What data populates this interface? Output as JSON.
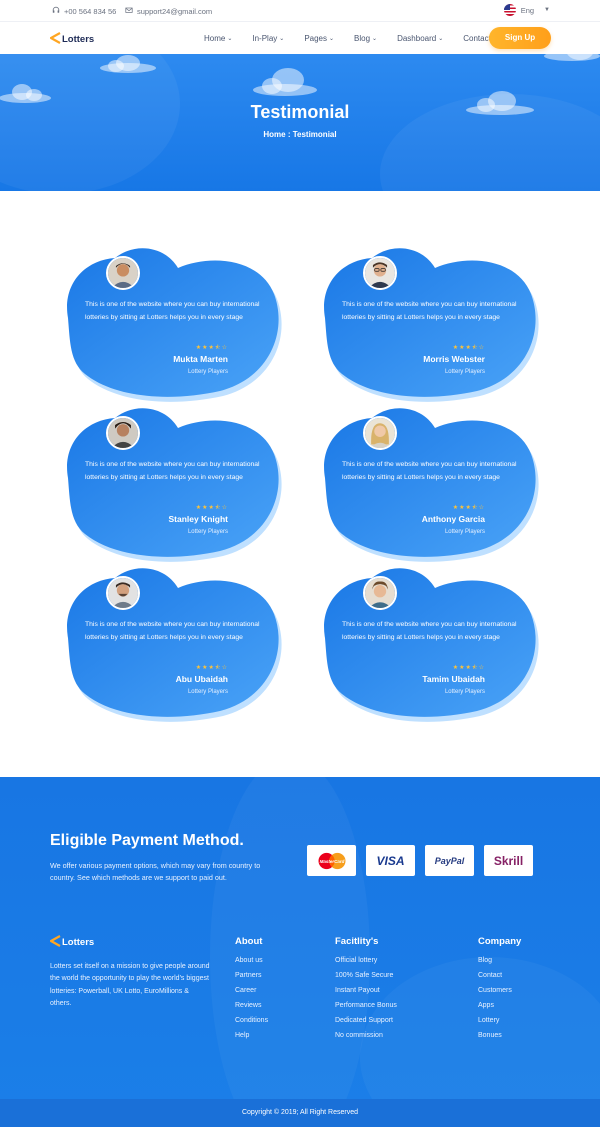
{
  "topbar": {
    "phone": "+00 564 834 56",
    "email": "support24@gmail.com",
    "language": "Eng"
  },
  "nav": {
    "logo_text": "Lotters",
    "menu": [
      {
        "label": "Home",
        "dropdown": true
      },
      {
        "label": "In-Play",
        "dropdown": true
      },
      {
        "label": "Pages",
        "dropdown": true
      },
      {
        "label": "Blog",
        "dropdown": true
      },
      {
        "label": "Dashboard",
        "dropdown": true
      },
      {
        "label": "Contact",
        "dropdown": false
      }
    ],
    "signup_label": "Sign Up"
  },
  "hero": {
    "title": "Testimonial",
    "breadcrumb": "Home : Testimonial"
  },
  "testimonials": [
    {
      "quote": "This is one of the website where you can buy international lotteries by sitting at Lotters helps you in every stage",
      "name": "Mukta Marten",
      "role": "Lottery Players",
      "rating": 3.5
    },
    {
      "quote": "This is one of the website where you can buy international lotteries by sitting at Lotters helps you in every stage",
      "name": "Morris Webster",
      "role": "Lottery Players",
      "rating": 3.5
    },
    {
      "quote": "This is one of the website where you can buy international lotteries by sitting at Lotters helps you in every stage",
      "name": "Stanley Knight",
      "role": "Lottery Players",
      "rating": 3.5
    },
    {
      "quote": "This is one of the website where you can buy international lotteries by sitting at Lotters helps you in every stage",
      "name": "Anthony Garcia",
      "role": "Lottery Players",
      "rating": 3.5
    },
    {
      "quote": "This is one of the website where you can buy international lotteries by sitting at Lotters helps you in every stage",
      "name": "Abu Ubaidah",
      "role": "Lottery Players",
      "rating": 3.5
    },
    {
      "quote": "This is one of the website where you can buy international lotteries by sitting at Lotters helps you in every stage",
      "name": "Tamim Ubaidah",
      "role": "Lottery Players",
      "rating": 3.5
    }
  ],
  "stars_glyphs": "★★★⯪☆",
  "payment": {
    "title": "Eligible Payment Method.",
    "description": "We offer various payment options, which may vary from country to country. See which methods are we support to paid out.",
    "methods": [
      "MasterCard",
      "VISA",
      "PayPal",
      "Skrill"
    ]
  },
  "footer": {
    "logo_text": "Lotters",
    "description": "Lotters set itself on a mission to give people around the world the opportunity to play the world's biggest lotteries: Powerball, UK Lotto, EuroMillions & others.",
    "columns": [
      {
        "title": "About",
        "links": [
          "About us",
          "Partners",
          "Career",
          "Reviews",
          "Conditions",
          "Help"
        ]
      },
      {
        "title": "Facitlity's",
        "links": [
          "Official lottery",
          "100% Safe Secure",
          "Instant Payout",
          "Performance Bonus",
          "Dedicated Support",
          "No commission"
        ]
      },
      {
        "title": "Company",
        "links": [
          "Blog",
          "Contact",
          "Customers",
          "Apps",
          "Lottery",
          "Bonues"
        ]
      }
    ],
    "copyright": "Copyright © 2019; All Right Reserved"
  },
  "colors": {
    "primary_blue": "#1b7fe8",
    "accent_orange": "#ffa623",
    "star": "#ffc338"
  }
}
